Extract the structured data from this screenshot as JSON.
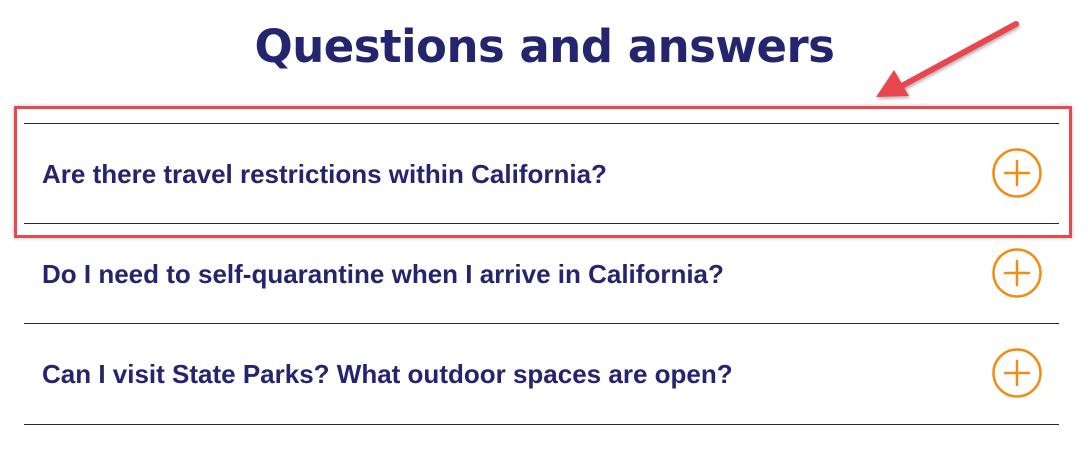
{
  "page": {
    "title": "Questions and answers"
  },
  "faq": {
    "items": [
      {
        "question": "Are there travel restrictions within California?",
        "icon": "plus-circle-icon"
      },
      {
        "question": "Do I need to self-quarantine when I arrive in California?",
        "icon": "plus-circle-icon"
      },
      {
        "question": "Can I visit State Parks? What outdoor spaces are open?",
        "icon": "plus-circle-icon"
      }
    ]
  },
  "colors": {
    "heading": "#25246f",
    "accent_icon": "#f28c13",
    "annotation": "#e8474f",
    "divider": "#2b2b2b"
  }
}
